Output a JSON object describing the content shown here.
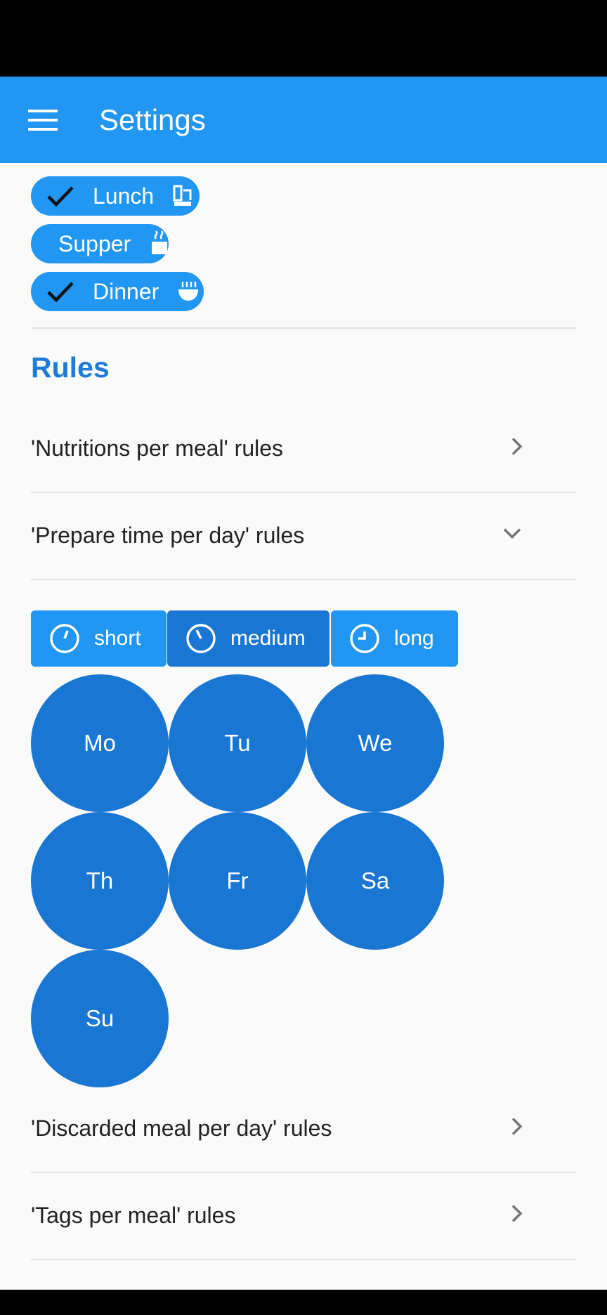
{
  "app_bar": {
    "title": "Settings",
    "menu_icon": "menu-icon"
  },
  "meals": [
    {
      "label": "Lunch",
      "checked": true,
      "icon": "lunch-icon"
    },
    {
      "label": "Supper",
      "checked": false,
      "icon": "supper-icon"
    },
    {
      "label": "Dinner",
      "checked": true,
      "icon": "dinner-icon"
    }
  ],
  "rules": {
    "title": "Rules",
    "items": [
      {
        "label": "'Nutritions per meal' rules",
        "state": "collapsed"
      },
      {
        "label": "'Prepare time per day' rules",
        "state": "expanded"
      },
      {
        "label": "'Discarded meal per day' rules",
        "state": "collapsed"
      },
      {
        "label": "'Tags per meal' rules",
        "state": "collapsed"
      }
    ]
  },
  "prepare_time": {
    "options": [
      {
        "label": "short",
        "selected": false
      },
      {
        "label": "medium",
        "selected": true
      },
      {
        "label": "long",
        "selected": false
      }
    ],
    "days": [
      "Mo",
      "Tu",
      "We",
      "Th",
      "Fr",
      "Sa",
      "Su"
    ]
  },
  "colors": {
    "primary": "#2196f3",
    "primary_dark": "#1976d2",
    "section_title": "#1e7bd6",
    "background": "#fafafa"
  }
}
